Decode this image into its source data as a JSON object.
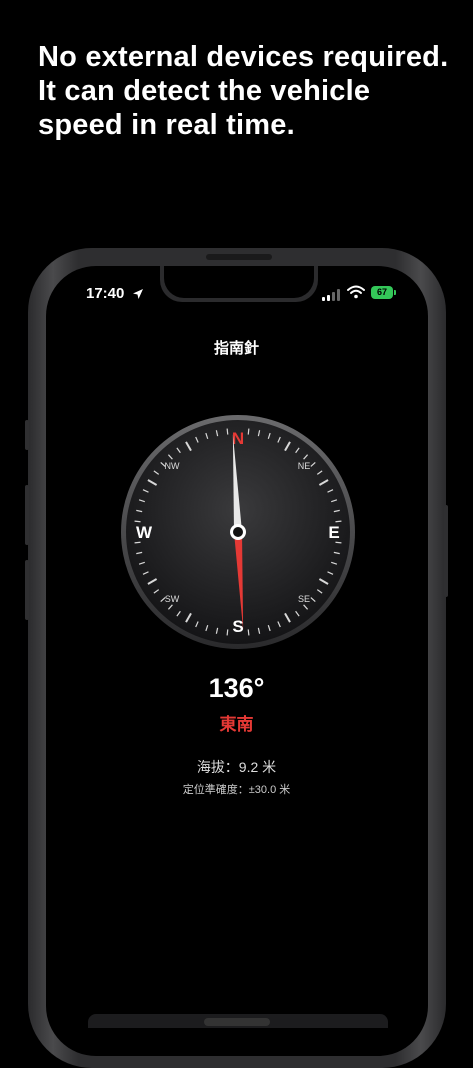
{
  "promo": {
    "headline": "No external devices required. It can detect the vehicle speed in real time."
  },
  "status_bar": {
    "time": "17:40",
    "battery": "67"
  },
  "app": {
    "title": "指南針",
    "compass": {
      "heading_deg": 136,
      "cardinals": {
        "n": "N",
        "e": "E",
        "s": "S",
        "w": "W"
      },
      "intercardinals": {
        "ne": "NE",
        "se": "SE",
        "sw": "SW",
        "nw": "NW"
      }
    },
    "heading_text": "136°",
    "direction_text": "東南",
    "altitude_text": "海拔：9.2 米",
    "accuracy_text": "定位準確度：±30.0 米"
  },
  "colors": {
    "accent_red": "#e53935",
    "battery_green": "#34c759"
  }
}
